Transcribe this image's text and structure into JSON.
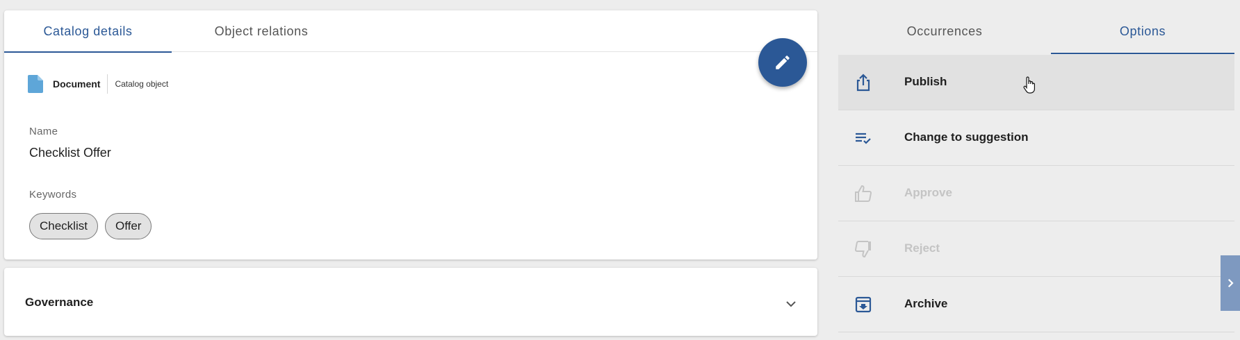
{
  "left_tabs": [
    {
      "label": "Catalog details",
      "active": true
    },
    {
      "label": "Object relations",
      "active": false
    }
  ],
  "object": {
    "type_label": "Document",
    "type_sub": "Catalog object",
    "name_label": "Name",
    "name_value": "Checklist Offer",
    "keywords_label": "Keywords",
    "keywords": [
      "Checklist",
      "Offer"
    ]
  },
  "governance": {
    "title": "Governance"
  },
  "right_tabs": [
    {
      "label": "Occurrences",
      "active": false
    },
    {
      "label": "Options",
      "active": true
    }
  ],
  "options": [
    {
      "label": "Publish",
      "icon": "publish-icon",
      "enabled": true
    },
    {
      "label": "Change to suggestion",
      "icon": "playlist-check-icon",
      "enabled": true
    },
    {
      "label": "Approve",
      "icon": "thumb-up-icon",
      "enabled": false
    },
    {
      "label": "Reject",
      "icon": "thumb-down-icon",
      "enabled": false
    },
    {
      "label": "Archive",
      "icon": "archive-icon",
      "enabled": true
    }
  ],
  "colors": {
    "primary": "#2b5896",
    "document_icon": "#5ea6d8",
    "side_toggle": "#7e99c0",
    "background": "#ededed",
    "disabled_text": "#c4c4c4"
  }
}
